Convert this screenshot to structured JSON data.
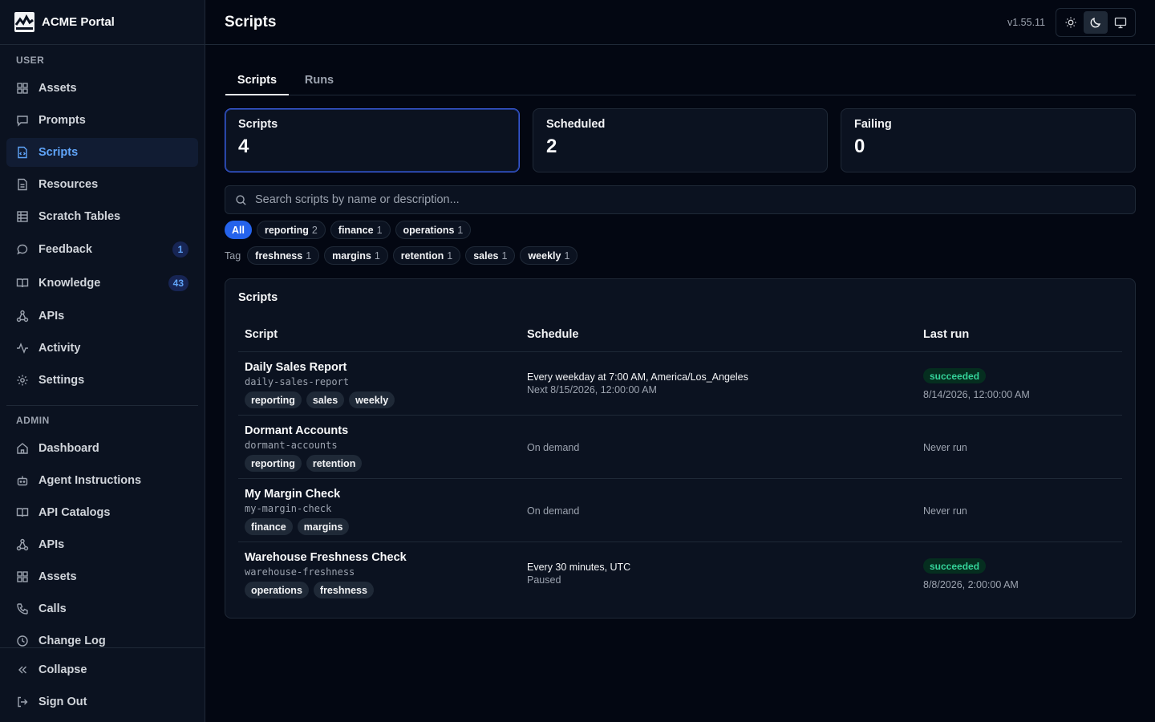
{
  "app": {
    "name": "ACME Portal"
  },
  "sidebar": {
    "user_section": "USER",
    "admin_section": "ADMIN",
    "user_items": [
      {
        "label": "Assets",
        "icon": "grid-icon"
      },
      {
        "label": "Prompts",
        "icon": "message-icon"
      },
      {
        "label": "Scripts",
        "icon": "script-file-icon",
        "active": true
      },
      {
        "label": "Resources",
        "icon": "file-icon"
      },
      {
        "label": "Scratch Tables",
        "icon": "table-icon"
      },
      {
        "label": "Feedback",
        "icon": "chat-bubble-icon",
        "badge": "1"
      },
      {
        "label": "Knowledge",
        "icon": "book-icon",
        "badge": "43"
      },
      {
        "label": "APIs",
        "icon": "network-icon"
      },
      {
        "label": "Activity",
        "icon": "pulse-icon"
      },
      {
        "label": "Settings",
        "icon": "gear-icon"
      }
    ],
    "admin_items": [
      {
        "label": "Dashboard",
        "icon": "home-icon"
      },
      {
        "label": "Agent Instructions",
        "icon": "bot-icon"
      },
      {
        "label": "API Catalogs",
        "icon": "book-icon"
      },
      {
        "label": "APIs",
        "icon": "network-icon"
      },
      {
        "label": "Assets",
        "icon": "grid-icon"
      },
      {
        "label": "Calls",
        "icon": "phone-icon"
      },
      {
        "label": "Change Log",
        "icon": "clock-icon"
      }
    ],
    "footer": {
      "collapse": "Collapse",
      "sign_out": "Sign Out"
    }
  },
  "header": {
    "title": "Scripts",
    "version": "v1.55.11",
    "theme_options": [
      "light",
      "dark",
      "system"
    ],
    "theme_selected": "dark"
  },
  "tabs": [
    {
      "label": "Scripts",
      "active": true
    },
    {
      "label": "Runs",
      "active": false
    }
  ],
  "stats": [
    {
      "label": "Scripts",
      "value": "4",
      "selected": true
    },
    {
      "label": "Scheduled",
      "value": "2",
      "selected": false
    },
    {
      "label": "Failing",
      "value": "0",
      "selected": false
    }
  ],
  "search": {
    "placeholder": "Search scripts by name or description...",
    "value": ""
  },
  "filters": {
    "all_label": "All",
    "category_chips": [
      {
        "label": "reporting",
        "count": "2"
      },
      {
        "label": "finance",
        "count": "1"
      },
      {
        "label": "operations",
        "count": "1"
      }
    ],
    "tag_label": "Tag",
    "tag_chips": [
      {
        "label": "freshness",
        "count": "1"
      },
      {
        "label": "margins",
        "count": "1"
      },
      {
        "label": "retention",
        "count": "1"
      },
      {
        "label": "sales",
        "count": "1"
      },
      {
        "label": "weekly",
        "count": "1"
      }
    ]
  },
  "table": {
    "title": "Scripts",
    "columns": [
      "Script",
      "Schedule",
      "Last run"
    ],
    "rows": [
      {
        "name": "Daily Sales Report",
        "slug": "daily-sales-report",
        "tags": [
          "reporting",
          "sales",
          "weekly"
        ],
        "schedule": "Every weekday at 7:00 AM, America/Los_Angeles",
        "schedule_sub": "Next 8/15/2026, 12:00:00 AM",
        "status": "succeeded",
        "last_run": "8/14/2026, 12:00:00 AM"
      },
      {
        "name": "Dormant Accounts",
        "slug": "dormant-accounts",
        "tags": [
          "reporting",
          "retention"
        ],
        "schedule": "On demand",
        "schedule_sub": "",
        "status": "",
        "last_run": "Never run"
      },
      {
        "name": "My Margin Check",
        "slug": "my-margin-check",
        "tags": [
          "finance",
          "margins"
        ],
        "schedule": "On demand",
        "schedule_sub": "",
        "status": "",
        "last_run": "Never run"
      },
      {
        "name": "Warehouse Freshness Check",
        "slug": "warehouse-freshness",
        "tags": [
          "operations",
          "freshness"
        ],
        "schedule": "Every 30 minutes, UTC",
        "schedule_sub": "Paused",
        "status": "succeeded",
        "last_run": "8/8/2026, 2:00:00 AM"
      }
    ]
  },
  "colors": {
    "accent": "#2563eb",
    "active_nav": "#60a5fa",
    "success": "#34d399",
    "background": "#030712"
  }
}
